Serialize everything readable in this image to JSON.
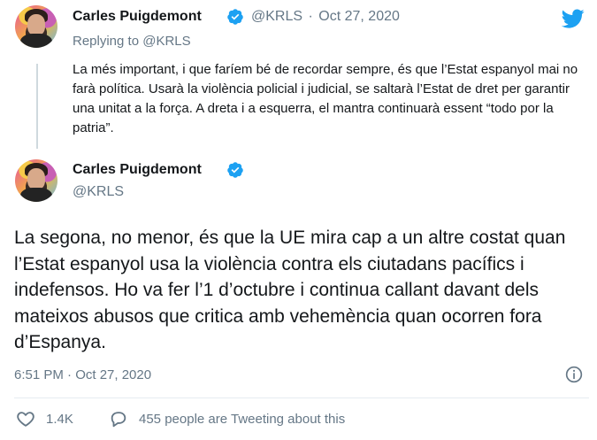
{
  "reply_tweet": {
    "author_name": "Carles Puigdemont",
    "handle": "@KRLS",
    "separator": "·",
    "date": "Oct 27, 2020",
    "replying_prefix": "Replying to ",
    "replying_handle": "@KRLS",
    "text": "La més important, i que faríem bé de recordar sempre, és que l’Estat espanyol mai no farà política. Usarà la violència policial i judicial, se saltarà l’Estat de dret per garantir una unitat a la força. A dreta i a esquerra, el mantra continuarà essent “todo por la patria”."
  },
  "main_tweet": {
    "author_name": "Carles Puigdemont",
    "handle": "@KRLS",
    "text": "La segona, no menor, és que la UE mira cap a un altre costat quan l’Estat espanyol usa la violència contra els ciutadans pacífics i indefensos. Ho va fer l’1 d’octubre i continua callant davant dels mateixos abusos que critica amb vehemència quan ocorren fora d’Espanya.",
    "timestamp": "6:51 PM · Oct 27, 2020"
  },
  "actions": {
    "likes": "1.4K",
    "tweeting_about": "455 people are Tweeting about this"
  },
  "colors": {
    "brand": "#1da1f2",
    "text": "#14171a",
    "secondary": "#657786"
  },
  "icons": {
    "verified": "verified-badge-icon",
    "logo": "twitter-bird-icon",
    "info": "info-icon",
    "like": "heart-icon",
    "reply": "speech-bubble-icon"
  }
}
